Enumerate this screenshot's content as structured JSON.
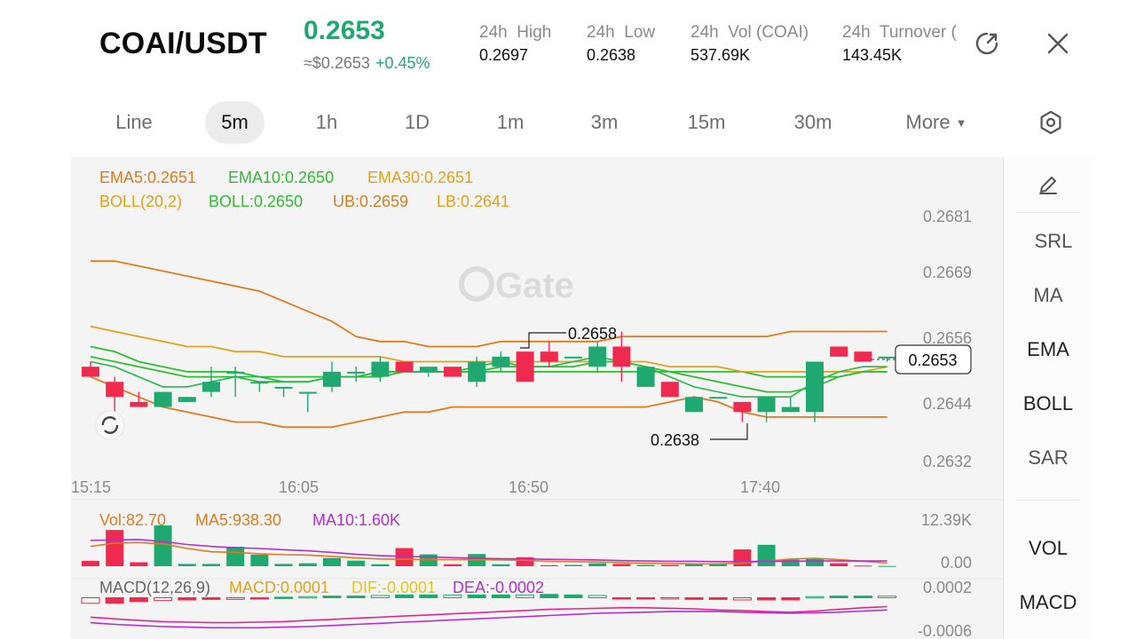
{
  "header": {
    "pair": "COAI/USDT",
    "price": "0.2653",
    "usd_price": "≈$0.2653",
    "change": "+0.45%",
    "stats": [
      {
        "label": "24h  High",
        "value": "0.2697"
      },
      {
        "label": "24h  Low",
        "value": "0.2638"
      },
      {
        "label": "24h  Vol (COAI)",
        "value": "537.69K"
      },
      {
        "label": "24h  Turnover (",
        "value": "143.45K"
      }
    ]
  },
  "timeframes": {
    "items": [
      "Line",
      "5m",
      "1h",
      "1D",
      "1m",
      "3m",
      "15m",
      "30m",
      "More"
    ],
    "active": "5m"
  },
  "indicators": {
    "ema": {
      "ema5": "EMA5:0.2651",
      "ema10": "EMA10:0.2650",
      "ema30": "EMA30:0.2651"
    },
    "boll": {
      "label": "BOLL(20,2)",
      "mid": "BOLL:0.2650",
      "ub": "UB:0.2659",
      "lb": "LB:0.2641"
    },
    "vol": {
      "vol": "Vol:82.70",
      "ma5": "MA5:938.30",
      "ma10": "MA10:1.60K"
    },
    "macd": {
      "label": "MACD(12,26,9)",
      "macd": "MACD:0.0001",
      "dif": "DIF:-0.0001",
      "dea": "DEA:-0.0002"
    }
  },
  "price_axis": [
    "0.2681",
    "0.2669",
    "0.2656",
    "0.2644",
    "0.2632"
  ],
  "current_price_tag": "0.2653",
  "marker_high": "0.2658",
  "marker_low": "0.2638",
  "time_axis": [
    "15:15",
    "16:05",
    "16:50",
    "17:40"
  ],
  "vol_axis": [
    "12.39K",
    "0.00"
  ],
  "macd_axis": [
    "0.0002",
    "-0.0006"
  ],
  "watermark": "Gate",
  "sidebar": [
    "SRL",
    "MA",
    "EMA",
    "BOLL",
    "SAR",
    "VOL",
    "MACD"
  ],
  "colors": {
    "up": "#1fa971",
    "down": "#f0294f",
    "ema5": "#e07b1a",
    "ema10": "#2ebd2e",
    "ema30": "#e0a21a",
    "purple": "#b22fd0"
  },
  "chart_data": {
    "type": "candlestick",
    "candles": [
      {
        "o": 0.2651,
        "h": 0.2652,
        "l": 0.2649,
        "c": 0.2649
      },
      {
        "o": 0.2648,
        "h": 0.2649,
        "l": 0.264,
        "c": 0.2645
      },
      {
        "o": 0.2644,
        "h": 0.2646,
        "l": 0.2643,
        "c": 0.2643
      },
      {
        "o": 0.2643,
        "h": 0.2646,
        "l": 0.2643,
        "c": 0.2646
      },
      {
        "o": 0.2644,
        "h": 0.2645,
        "l": 0.2644,
        "c": 0.2645
      },
      {
        "o": 0.2646,
        "h": 0.2651,
        "l": 0.2645,
        "c": 0.2648
      },
      {
        "o": 0.265,
        "h": 0.2651,
        "l": 0.2645,
        "c": 0.265
      },
      {
        "o": 0.2648,
        "h": 0.2648,
        "l": 0.2646,
        "c": 0.2648
      },
      {
        "o": 0.2647,
        "h": 0.2647,
        "l": 0.2645,
        "c": 0.2647
      },
      {
        "o": 0.2646,
        "h": 0.2646,
        "l": 0.2642,
        "c": 0.2646
      },
      {
        "o": 0.2647,
        "h": 0.2652,
        "l": 0.2646,
        "c": 0.265
      },
      {
        "o": 0.265,
        "h": 0.2651,
        "l": 0.2648,
        "c": 0.265
      },
      {
        "o": 0.2649,
        "h": 0.2653,
        "l": 0.2648,
        "c": 0.2652
      },
      {
        "o": 0.2652,
        "h": 0.2652,
        "l": 0.265,
        "c": 0.265
      },
      {
        "o": 0.265,
        "h": 0.2651,
        "l": 0.2649,
        "c": 0.2651
      },
      {
        "o": 0.2651,
        "h": 0.2651,
        "l": 0.2649,
        "c": 0.2649
      },
      {
        "o": 0.2648,
        "h": 0.2653,
        "l": 0.2647,
        "c": 0.2652
      },
      {
        "o": 0.2651,
        "h": 0.2654,
        "l": 0.265,
        "c": 0.2653
      },
      {
        "o": 0.2654,
        "h": 0.2654,
        "l": 0.2648,
        "c": 0.2648
      },
      {
        "o": 0.2654,
        "h": 0.2656,
        "l": 0.2651,
        "c": 0.2652
      },
      {
        "o": 0.2653,
        "h": 0.2653,
        "l": 0.2653,
        "c": 0.2653
      },
      {
        "o": 0.2651,
        "h": 0.2656,
        "l": 0.265,
        "c": 0.2655
      },
      {
        "o": 0.2655,
        "h": 0.2658,
        "l": 0.2648,
        "c": 0.2651
      },
      {
        "o": 0.2647,
        "h": 0.2651,
        "l": 0.2647,
        "c": 0.2651
      },
      {
        "o": 0.2648,
        "h": 0.2648,
        "l": 0.2645,
        "c": 0.2645
      },
      {
        "o": 0.2642,
        "h": 0.2645,
        "l": 0.2642,
        "c": 0.2645
      },
      {
        "o": 0.2645,
        "h": 0.2645,
        "l": 0.2645,
        "c": 0.2645
      },
      {
        "o": 0.2644,
        "h": 0.2644,
        "l": 0.264,
        "c": 0.2642
      },
      {
        "o": 0.2642,
        "h": 0.2645,
        "l": 0.264,
        "c": 0.2645
      },
      {
        "o": 0.2642,
        "h": 0.2645,
        "l": 0.2642,
        "c": 0.2643
      },
      {
        "o": 0.2642,
        "h": 0.2652,
        "l": 0.264,
        "c": 0.2652
      },
      {
        "o": 0.2655,
        "h": 0.2655,
        "l": 0.2653,
        "c": 0.2653
      },
      {
        "o": 0.2654,
        "h": 0.2654,
        "l": 0.2652,
        "c": 0.2652
      },
      {
        "o": 0.2653,
        "h": 0.2653,
        "l": 0.2652,
        "c": 0.2653
      }
    ],
    "ylim": [
      0.2628,
      0.2686
    ],
    "ema5": [
      0.2652,
      0.2651,
      0.2649,
      0.2647,
      0.2647,
      0.2648,
      0.2649,
      0.2649,
      0.2648,
      0.2648,
      0.2649,
      0.2649,
      0.265,
      0.265,
      0.265,
      0.265,
      0.2651,
      0.2652,
      0.2651,
      0.2651,
      0.2652,
      0.2653,
      0.2652,
      0.2651,
      0.2649,
      0.2647,
      0.2646,
      0.2645,
      0.2645,
      0.2645,
      0.2648,
      0.265,
      0.2651,
      0.2651
    ],
    "ema10": [
      0.2655,
      0.2654,
      0.2652,
      0.2651,
      0.265,
      0.265,
      0.265,
      0.2649,
      0.2649,
      0.2649,
      0.2649,
      0.2649,
      0.265,
      0.265,
      0.265,
      0.265,
      0.265,
      0.2651,
      0.2651,
      0.2651,
      0.2651,
      0.2652,
      0.2652,
      0.2651,
      0.265,
      0.2649,
      0.2648,
      0.2647,
      0.2646,
      0.2646,
      0.2647,
      0.2649,
      0.265,
      0.265
    ],
    "ema30": [
      0.2659,
      0.2658,
      0.2657,
      0.2656,
      0.2655,
      0.2655,
      0.2654,
      0.2654,
      0.2653,
      0.2653,
      0.2653,
      0.2653,
      0.2653,
      0.2652,
      0.2652,
      0.2652,
      0.2652,
      0.2652,
      0.2652,
      0.2652,
      0.2652,
      0.2652,
      0.2652,
      0.2652,
      0.2651,
      0.2651,
      0.2651,
      0.265,
      0.265,
      0.265,
      0.265,
      0.265,
      0.265,
      0.2651
    ],
    "boll_ub": [
      0.2672,
      0.2672,
      0.2671,
      0.267,
      0.2669,
      0.2668,
      0.2667,
      0.2666,
      0.2664,
      0.2662,
      0.266,
      0.2657,
      0.2656,
      0.2656,
      0.2655,
      0.2655,
      0.2655,
      0.2656,
      0.2656,
      0.2656,
      0.2656,
      0.2656,
      0.2657,
      0.2657,
      0.2657,
      0.2657,
      0.2657,
      0.2657,
      0.2657,
      0.2658,
      0.2658,
      0.2658,
      0.2658,
      0.2658
    ],
    "boll_mid": [
      0.2653,
      0.2652,
      0.2651,
      0.265,
      0.2649,
      0.2649,
      0.2649,
      0.2648,
      0.2648,
      0.2648,
      0.2649,
      0.2649,
      0.2649,
      0.265,
      0.265,
      0.265,
      0.265,
      0.265,
      0.265,
      0.265,
      0.265,
      0.265,
      0.265,
      0.265,
      0.265,
      0.265,
      0.265,
      0.265,
      0.2649,
      0.2649,
      0.2649,
      0.2649,
      0.265,
      0.265
    ],
    "boll_lb": [
      0.2649,
      0.2647,
      0.2645,
      0.2643,
      0.2642,
      0.2641,
      0.264,
      0.264,
      0.2639,
      0.2639,
      0.2639,
      0.264,
      0.2641,
      0.2642,
      0.2642,
      0.2643,
      0.2643,
      0.2643,
      0.2643,
      0.2643,
      0.2643,
      0.2643,
      0.2643,
      0.2643,
      0.2644,
      0.2645,
      0.2644,
      0.2642,
      0.2641,
      0.2641,
      0.2641,
      0.2641,
      0.2641,
      0.2641
    ],
    "volume": [
      1600,
      11000,
      1200,
      12390,
      700,
      700,
      5900,
      3500,
      700,
      900,
      2500,
      1700,
      600,
      5500,
      3600,
      600,
      3700,
      600,
      2700,
      300,
      400,
      900,
      700,
      400,
      400,
      600,
      900,
      5100,
      6500,
      2000,
      2300,
      900,
      200,
      80
    ],
    "vol_ma5": [
      6000,
      7000,
      7200,
      6800,
      5400,
      4400,
      4200,
      3800,
      3500,
      3400,
      3000,
      2500,
      2200,
      2100,
      2000,
      2000,
      2000,
      1900,
      1800,
      1500,
      1400,
      1300,
      1100,
      900,
      800,
      700,
      700,
      1000,
      1500,
      2200,
      2400,
      2000,
      1500,
      938
    ],
    "vol_ma10": [
      7800,
      8000,
      8100,
      7500,
      6600,
      6000,
      5600,
      5400,
      5000,
      4700,
      4200,
      3600,
      3200,
      3000,
      2800,
      2600,
      2400,
      2300,
      2200,
      2100,
      2000,
      1900,
      1700,
      1600,
      1500,
      1500,
      1400,
      1400,
      1500,
      1500,
      1600,
      1600,
      1600,
      1600
    ],
    "macd_hist": [
      -0.0001,
      -0.0001,
      -7e-05,
      -5e-05,
      -4e-05,
      -3e-05,
      -3e-05,
      -2e-05,
      1e-05,
      2e-05,
      3e-05,
      3e-05,
      4e-05,
      5e-05,
      5e-05,
      5e-05,
      5e-05,
      5e-05,
      5e-05,
      6e-05,
      5e-05,
      4e-05,
      -1e-05,
      -2e-05,
      -2e-05,
      -3e-05,
      -3e-05,
      -4e-05,
      -4e-05,
      -4e-05,
      2e-05,
      3e-05,
      3e-05,
      3e-05
    ],
    "dif": [
      -0.00035,
      -0.00038,
      -0.00041,
      -0.00043,
      -0.00044,
      -0.00045,
      -0.00045,
      -0.00044,
      -0.00043,
      -0.00041,
      -0.00039,
      -0.00037,
      -0.00035,
      -0.00033,
      -0.00031,
      -0.00029,
      -0.00027,
      -0.00025,
      -0.00023,
      -0.00021,
      -0.0002,
      -0.00019,
      -0.00018,
      -0.00018,
      -0.00019,
      -0.0002,
      -0.00022,
      -0.00023,
      -0.00025,
      -0.00026,
      -0.00024,
      -0.00021,
      -0.00018,
      -0.00016
    ],
    "dea": [
      -0.00045,
      -0.00048,
      -0.0005,
      -0.00052,
      -0.00053,
      -0.00054,
      -0.00054,
      -0.00054,
      -0.00053,
      -0.00052,
      -0.0005,
      -0.00048,
      -0.00046,
      -0.00044,
      -0.00042,
      -0.0004,
      -0.00038,
      -0.00036,
      -0.00034,
      -0.00032,
      -0.0003,
      -0.00028,
      -0.00027,
      -0.00026,
      -0.00025,
      -0.00025,
      -0.00025,
      -0.00026,
      -0.00027,
      -0.00028,
      -0.00027,
      -0.00026,
      -0.00024,
      -0.00022
    ],
    "macd_ylim": [
      -0.0006,
      0.0002
    ],
    "vol_ylim": [
      0,
      12390
    ]
  }
}
